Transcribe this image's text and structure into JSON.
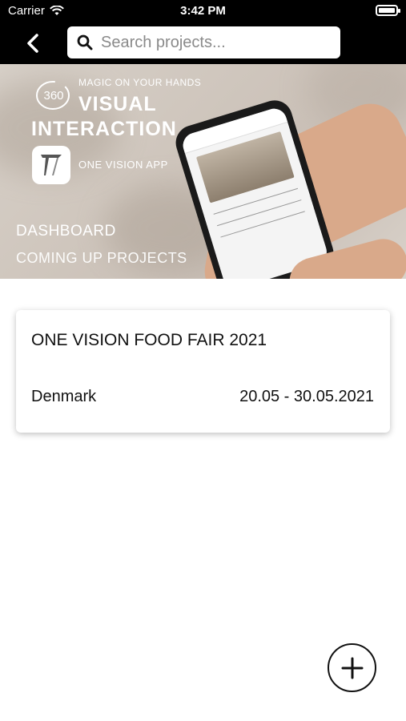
{
  "status_bar": {
    "carrier": "Carrier",
    "time": "3:42 PM"
  },
  "nav": {
    "search_placeholder": "Search projects..."
  },
  "hero": {
    "tagline": "MAGIC ON YOUR HANDS",
    "badge": "360",
    "title_line1": "VISUAL",
    "title_line2": "INTERACTION",
    "app_name": "ONE VISION APP",
    "section_title": "DASHBOARD",
    "section_subtitle": "COMING UP PROJECTS"
  },
  "projects": [
    {
      "name": "ONE VISION FOOD FAIR 2021",
      "country": "Denmark",
      "dates": "20.05 - 30.05.2021"
    }
  ],
  "colors": {
    "bar_bg": "#000000",
    "card_bg": "#ffffff",
    "text": "#111111"
  },
  "icons": {
    "back": "chevron-left-icon",
    "search": "search-icon",
    "add": "plus-icon",
    "wifi": "wifi-icon",
    "battery": "battery-icon"
  }
}
